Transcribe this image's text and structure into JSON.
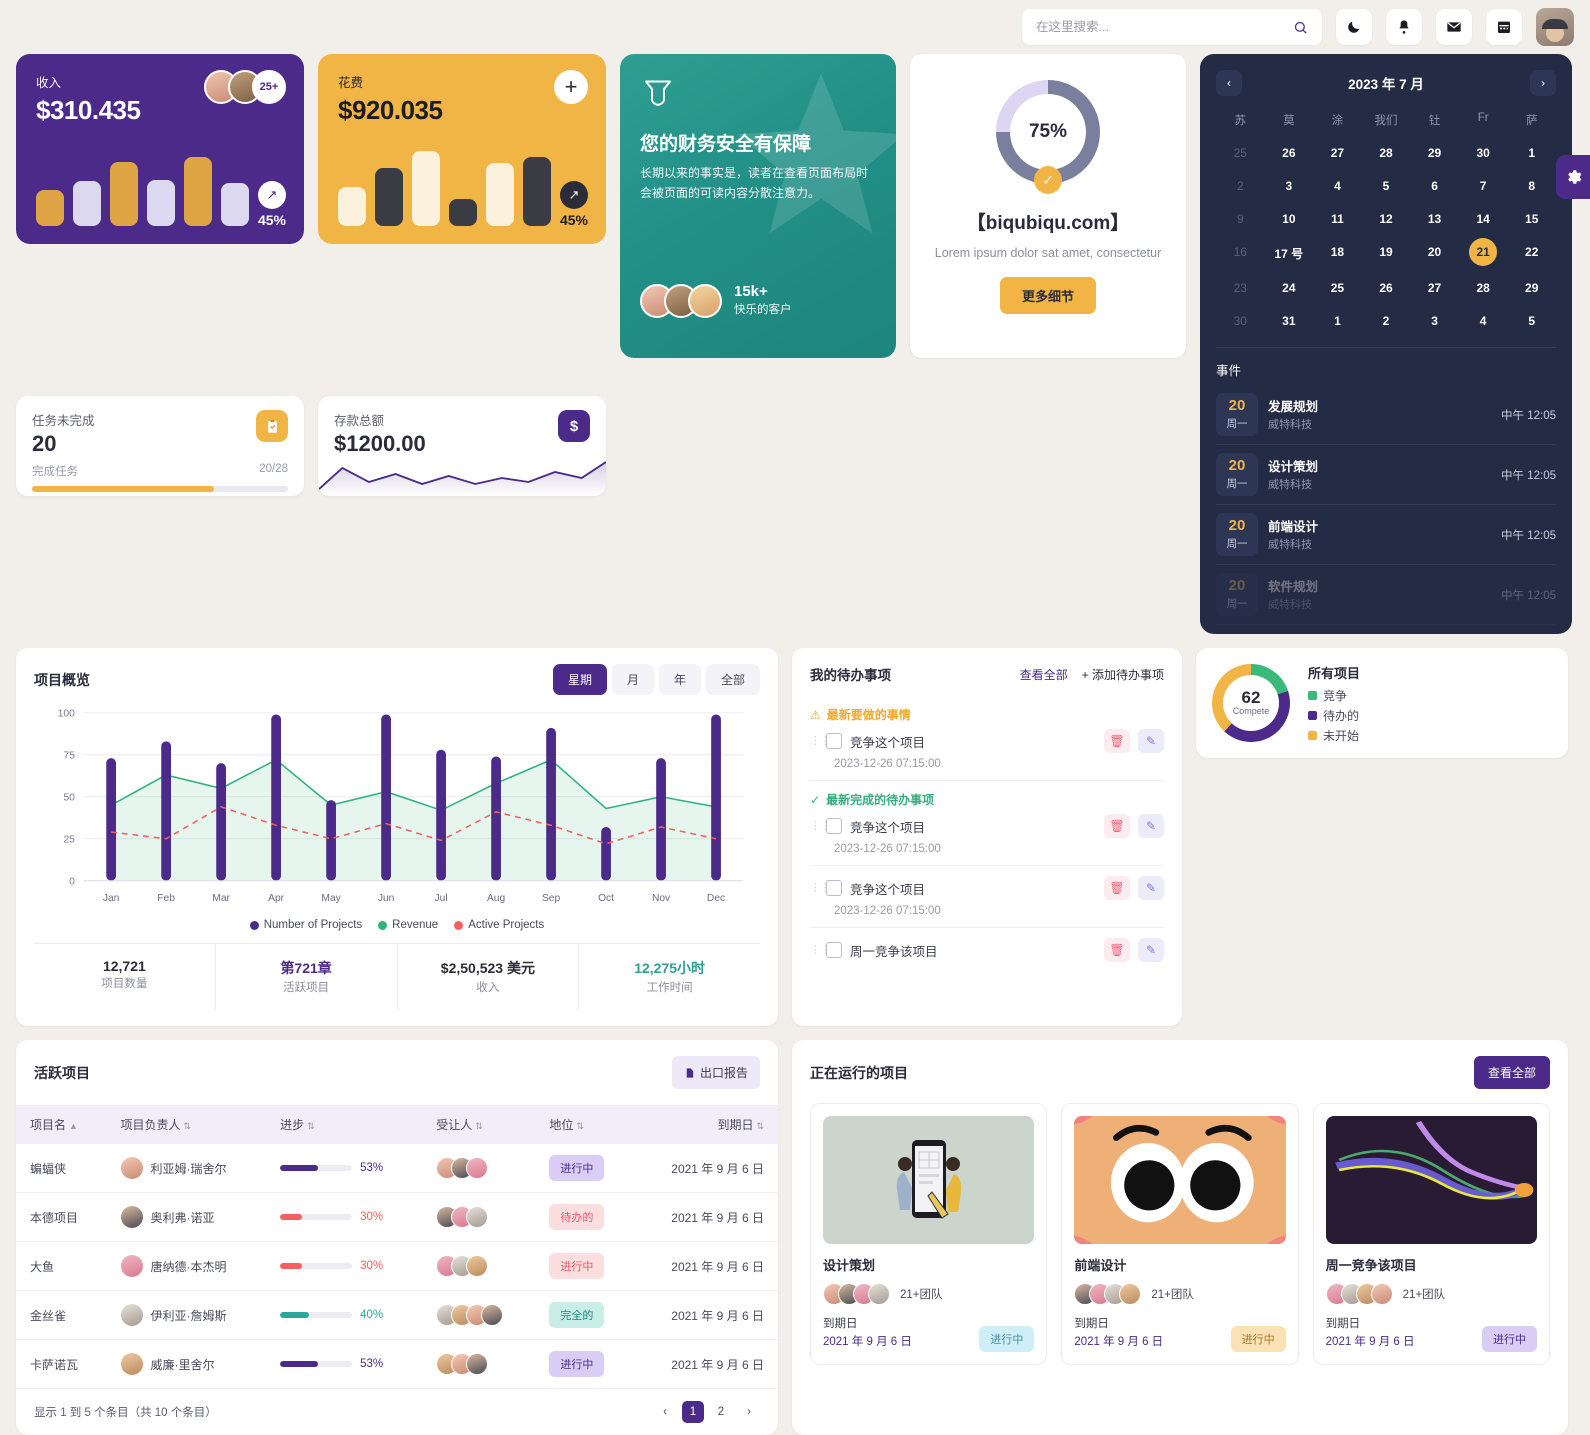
{
  "header": {
    "search_placeholder": "在这里搜索...",
    "search_value": "",
    "icons": [
      "moon-icon",
      "bell-icon",
      "mail-icon",
      "calendar-icon"
    ]
  },
  "revenue_card": {
    "label": "收入",
    "value": "$310.435",
    "badge": "25+",
    "pct": "45%",
    "bars": [
      48,
      60,
      86,
      62,
      92,
      58
    ]
  },
  "expense_card": {
    "label": "花费",
    "value": "$920.035",
    "pct": "45%",
    "bars": [
      52,
      78,
      100,
      36,
      84,
      92
    ]
  },
  "tasks_card": {
    "label": "任务未完成",
    "value": "20",
    "sub_label": "完成任务",
    "ratio": "20/28",
    "progress_pct": 71
  },
  "deposit_card": {
    "label": "存款总额",
    "value": "$1200.00"
  },
  "promo_card": {
    "title": "您的财务安全有保障",
    "body": "长期以来的事实是，读者在查看页面布局时会被页面的可读内容分散注意力。",
    "count": "15k+",
    "count_label": "快乐的客户"
  },
  "circle_card": {
    "percent": "75%",
    "brand": "【biqubiqu.com】",
    "lorem": "Lorem ipsum dolor sat amet, consectetur",
    "button": "更多细节"
  },
  "calendar": {
    "title": "2023 年 7 月",
    "prev": "‹",
    "next": "›",
    "dow": [
      "苏",
      "莫",
      "涂",
      "我们",
      "钍",
      "Fr",
      "萨"
    ],
    "weeks": [
      [
        {
          "d": "25",
          "m": true
        },
        {
          "d": "26"
        },
        {
          "d": "27"
        },
        {
          "d": "28"
        },
        {
          "d": "29"
        },
        {
          "d": "30"
        },
        {
          "d": "1"
        }
      ],
      [
        {
          "d": "2",
          "m": true
        },
        {
          "d": "3"
        },
        {
          "d": "4"
        },
        {
          "d": "5"
        },
        {
          "d": "6"
        },
        {
          "d": "7"
        },
        {
          "d": "8"
        }
      ],
      [
        {
          "d": "9",
          "m": true
        },
        {
          "d": "10"
        },
        {
          "d": "11"
        },
        {
          "d": "12"
        },
        {
          "d": "13"
        },
        {
          "d": "14"
        },
        {
          "d": "15"
        }
      ],
      [
        {
          "d": "16",
          "m": true
        },
        {
          "d": "17 号"
        },
        {
          "d": "18"
        },
        {
          "d": "19"
        },
        {
          "d": "20"
        },
        {
          "d": "21",
          "sel": true
        },
        {
          "d": "22"
        }
      ],
      [
        {
          "d": "23",
          "m": true
        },
        {
          "d": "24"
        },
        {
          "d": "25"
        },
        {
          "d": "26"
        },
        {
          "d": "27"
        },
        {
          "d": "28"
        },
        {
          "d": "29"
        }
      ],
      [
        {
          "d": "30",
          "m": true
        },
        {
          "d": "31"
        },
        {
          "d": "1"
        },
        {
          "d": "2"
        },
        {
          "d": "3"
        },
        {
          "d": "4"
        },
        {
          "d": "5"
        }
      ]
    ],
    "events_title": "事件",
    "events": [
      {
        "day": "20",
        "dow": "周一",
        "name": "发展规划",
        "org": "威特科技",
        "time": "中午 12:05"
      },
      {
        "day": "20",
        "dow": "周一",
        "name": "设计策划",
        "org": "威特科技",
        "time": "中午 12:05"
      },
      {
        "day": "20",
        "dow": "周一",
        "name": "前端设计",
        "org": "威特科技",
        "time": "中午 12:05"
      },
      {
        "day": "20",
        "dow": "周一",
        "name": "软件规划",
        "org": "威特科技",
        "time": "中午 12:05"
      }
    ]
  },
  "chart_card": {
    "title": "项目概览",
    "segments": [
      "星期",
      "月",
      "年",
      "全部"
    ],
    "active_segment": "星期"
  },
  "chart_data": {
    "type": "bar",
    "title": "项目概览",
    "categories": [
      "Jan",
      "Feb",
      "Mar",
      "Apr",
      "May",
      "Jun",
      "Jul",
      "Aug",
      "Sep",
      "Oct",
      "Nov",
      "Dec"
    ],
    "series": [
      {
        "name": "Number of Projects",
        "type": "bar",
        "color": "#4b2a8a",
        "values": [
          73,
          83,
          70,
          99,
          48,
          99,
          78,
          74,
          91,
          32,
          73,
          99
        ]
      },
      {
        "name": "Revenue",
        "type": "area",
        "color": "#2fb37c",
        "values": [
          45,
          63,
          55,
          72,
          45,
          53,
          42,
          58,
          72,
          43,
          50,
          44
        ]
      },
      {
        "name": "Active Projects",
        "type": "line-dashed",
        "color": "#f4605f",
        "values": [
          29,
          25,
          44,
          33,
          25,
          34,
          24,
          41,
          33,
          22,
          32,
          25
        ]
      }
    ],
    "ylim": [
      0,
      100
    ],
    "yticks": [
      0,
      25,
      50,
      75,
      100
    ],
    "xlabel": "",
    "ylabel": "",
    "grid": true,
    "legend_position": "bottom"
  },
  "kpis": [
    {
      "value": "12,721",
      "label": "项目数量",
      "color": "#2c2c38"
    },
    {
      "value": "第721章",
      "label": "活跃项目",
      "color": "#4b2a8a"
    },
    {
      "value": "$2,50,523 美元",
      "label": "收入",
      "color": "#2c2c38"
    },
    {
      "value": "12,275小时",
      "label": "工作时间",
      "color": "#2f9e92"
    }
  ],
  "todo": {
    "title": "我的待办事项",
    "view_all": "查看全部",
    "add": "+ 添加待办事项",
    "section_new": "最新要做的事情",
    "section_done": "最新完成的待办事项",
    "items": [
      {
        "text": "竞争这个项目",
        "date": "2023-12-26 07:15:00"
      },
      {
        "text": "竞争这个项目",
        "date": "2023-12-26 07:15:00"
      },
      {
        "text": "竞争这个项目",
        "date": "2023-12-26 07:15:00"
      },
      {
        "text": "周一竞争该项目",
        "date": ""
      }
    ]
  },
  "all_projects": {
    "center_value": "62",
    "center_label": "Compete",
    "title": "所有项目",
    "legend": [
      {
        "label": "竞争",
        "color": "#3aba79"
      },
      {
        "label": "待办的",
        "color": "#4b2a8a"
      },
      {
        "label": "未开始",
        "color": "#f0b545"
      }
    ]
  },
  "projects_table": {
    "title": "活跃项目",
    "export_label": "出口报告",
    "columns": [
      "项目名",
      "项目负责人",
      "进步",
      "受让人",
      "地位",
      "到期日"
    ],
    "rows": [
      {
        "name": "蝙蝠侠",
        "owner": "利亚姆·瑞舍尔",
        "progress": 53,
        "progress_label": "53%",
        "bar_color": "#4b2a8a",
        "status": "进行中",
        "status_bg": "#d9cdf5",
        "status_fg": "#4b2a8a",
        "due": "2021 年 9 月 6 日",
        "members": 3
      },
      {
        "name": "本德项目",
        "owner": "奥利弗·诺亚",
        "progress": 30,
        "progress_label": "30%",
        "bar_color": "#f4605f",
        "status": "待办的",
        "status_bg": "#fcdede",
        "status_fg": "#e8566a",
        "due": "2021 年 9 月 6 日",
        "members": 3
      },
      {
        "name": "大鱼",
        "owner": "唐纳德·本杰明",
        "progress": 30,
        "progress_label": "30%",
        "bar_color": "#f4605f",
        "status": "进行中",
        "status_bg": "#fcdede",
        "status_fg": "#e8566a",
        "due": "2021 年 9 月 6 日",
        "members": 3
      },
      {
        "name": "金丝雀",
        "owner": "伊利亚·詹姆斯",
        "progress": 40,
        "progress_label": "40%",
        "bar_color": "#2aa79b",
        "status": "完全的",
        "status_bg": "#c9eee8",
        "status_fg": "#1d857d",
        "due": "2021 年 9 月 6 日",
        "members": 4
      },
      {
        "name": "卡萨诺瓦",
        "owner": "威廉·里舍尔",
        "progress": 53,
        "progress_label": "53%",
        "bar_color": "#4b2a8a",
        "status": "进行中",
        "status_bg": "#d9cdf5",
        "status_fg": "#4b2a8a",
        "due": "2021 年 9 月 6 日",
        "members": 3
      }
    ],
    "footer": "显示 1 到 5 个条目（共 10 个条目）",
    "pages": [
      "1",
      "2"
    ],
    "active_page": "1"
  },
  "running_projects": {
    "title": "正在运行的项目",
    "view_all": "查看全部",
    "due_label": "到期日",
    "cards": [
      {
        "name": "设计策划",
        "team": "21+团队",
        "due": "2021 年 9 月 6 日",
        "status": "进行中",
        "status_bg": "#cfeef7",
        "status_fg": "#4a8fa8",
        "thumb": "wireframe-illustration"
      },
      {
        "name": "前端设计",
        "team": "21+团队",
        "due": "2021 年 9 月 6 日",
        "status": "进行中",
        "status_bg": "#fbe2b4",
        "status_fg": "#a8742a",
        "thumb": "cartoon-face-illustration"
      },
      {
        "name": "周一竞争该项目",
        "team": "21+团队",
        "due": "2021 年 9 月 6 日",
        "status": "进行中",
        "status_bg": "#d9cdf5",
        "status_fg": "#4b2a8a",
        "thumb": "waves-chart-illustration"
      }
    ]
  },
  "settings_tab": "gear-icon"
}
